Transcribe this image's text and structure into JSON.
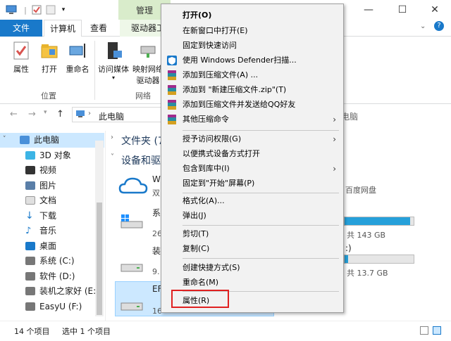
{
  "title_bar": {
    "manage_tab": "管理",
    "minimize": "—",
    "maximize": "☐",
    "close": "✕"
  },
  "tabs": {
    "file": "文件",
    "computer": "计算机",
    "view": "查看",
    "drive_tools": "驱动器工"
  },
  "ribbon": {
    "buttons": [
      {
        "label": "属性"
      },
      {
        "label": "打开"
      },
      {
        "label": "重命名"
      },
      {
        "label": "访问媒体"
      },
      {
        "label": "映射网络驱动器"
      }
    ],
    "groups": {
      "location": "位置",
      "network": "网络"
    }
  },
  "address": {
    "path": "此电脑",
    "search_fragment": "电脑"
  },
  "nav_pane": {
    "items": [
      {
        "label": "此电脑"
      },
      {
        "label": "3D 对象"
      },
      {
        "label": "视频"
      },
      {
        "label": "图片"
      },
      {
        "label": "文档"
      },
      {
        "label": "下载"
      },
      {
        "label": "音乐"
      },
      {
        "label": "桌面"
      },
      {
        "label": "系统 (C:)"
      },
      {
        "label": "软件 (D:)"
      },
      {
        "label": "装机之家好 (E:)"
      },
      {
        "label": "EasyU (F:)"
      }
    ]
  },
  "content": {
    "folders_head": "文件夹 (7",
    "devices_head": "设备和驱",
    "wps_head": "W",
    "wps_sub": "双",
    "baidu_frag": "百度网盘",
    "drive1_name": "系",
    "drive1_sub": "26",
    "drive1_free": "共 143 GB",
    "drive2_name": "装",
    "drive2_sub": "9.",
    "drive2_free": "共 13.7 GB",
    "drive3_name": "EF",
    "drive3_sub": "16",
    "drive1_fill": 0.95,
    "drive2_fill": 0.05
  },
  "status": {
    "count": "14 个项目",
    "selected": "选中 1 个项目"
  },
  "context_menu": {
    "items": [
      {
        "label": "打开(O)",
        "bold": true
      },
      {
        "label": "在新窗口中打开(E)"
      },
      {
        "label": "固定到快速访问"
      },
      {
        "label": "使用 Windows Defender扫描...",
        "icon": "defender-shield-icon"
      },
      {
        "label": "添加到压缩文件(A) ...",
        "icon": "winrar-icon"
      },
      {
        "label": "添加到 \"新建压缩文件.zip\"(T)",
        "icon": "winrar-icon"
      },
      {
        "label": "添加到压缩文件并发送给QQ好友",
        "icon": "winrar-icon"
      },
      {
        "label": "其他压缩命令",
        "icon": "winrar-icon",
        "arrow": "›"
      },
      {
        "label": "授予访问权限(G)",
        "arrow": "›"
      },
      {
        "label": "以便携式设备方式打开"
      },
      {
        "label": "包含到库中(I)",
        "arrow": "›"
      },
      {
        "label": "固定到\"开始\"屏幕(P)"
      },
      {
        "label": "格式化(A)..."
      },
      {
        "label": "弹出(J)"
      },
      {
        "label": "剪切(T)"
      },
      {
        "label": "复制(C)"
      },
      {
        "label": "创建快捷方式(S)"
      },
      {
        "label": "重命名(M)"
      },
      {
        "label": "属性(R)"
      }
    ]
  },
  "colors": {
    "file_tab": "#1979ca",
    "manage_tab": "#d9eccb",
    "selection": "#cce8ff",
    "bar_fill": "#26a0da",
    "highlight": "#e02020"
  }
}
